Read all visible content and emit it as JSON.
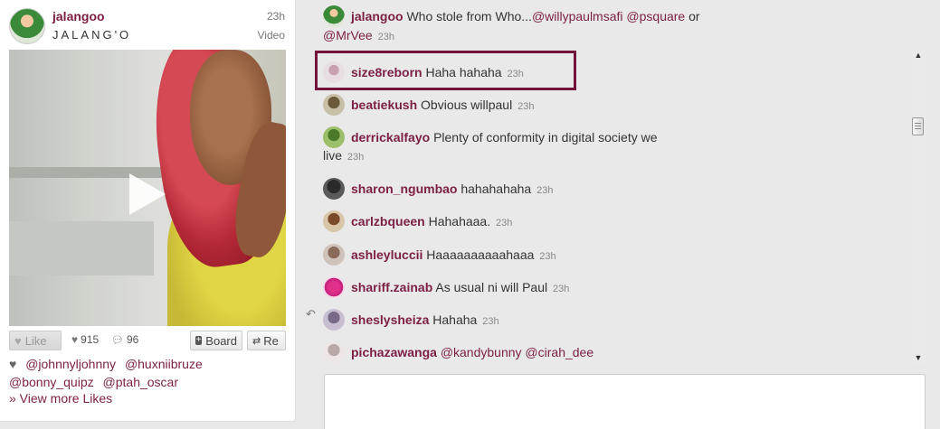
{
  "pin": {
    "author": "jalangoo",
    "author_subtitle": "JALANG'O",
    "time": "23h",
    "media_type": "Video",
    "like_label": "Like",
    "like_count": "915",
    "comment_count": "96",
    "board_label": "Board",
    "repin_label": "Re",
    "likers": [
      "@johnnyljohnny",
      "@huxniibruze",
      "@bonny_quipz",
      "@ptah_oscar"
    ],
    "view_more": "» View more Likes"
  },
  "top_comment": {
    "user": "jalangoo",
    "text": "Who stole from Who...",
    "mention1": "@willypaulmsafi",
    "mention2": "@psquare",
    "or": "or",
    "mention3": "@MrVee",
    "time": "23h"
  },
  "comments": [
    {
      "user": "size8reborn",
      "text": "Haha hahaha",
      "time": "23h"
    },
    {
      "user": "beatiekush",
      "text": "Obvious willpaul",
      "time": "23h"
    },
    {
      "user": "derrickalfayo",
      "text": "Plenty of conformity in digital society we",
      "text2": "live",
      "time": "23h"
    },
    {
      "user": "sharon_ngumbao",
      "text": "hahahahaha",
      "time": "23h"
    },
    {
      "user": "carlzbqueen",
      "text": "Hahahaaa.",
      "time": "23h"
    },
    {
      "user": "ashleyluccii",
      "text": "Haaaaaaaaaahaaa",
      "time": "23h"
    },
    {
      "user": "shariff.zainab",
      "text": "As usual ni will Paul",
      "time": "23h"
    },
    {
      "user": "sheslysheiza",
      "text": "Hahaha",
      "time": "23h"
    },
    {
      "user": "pichazawanga",
      "mention1": "@kandybunny",
      "mention2": "@cirah_dee"
    }
  ],
  "icons": {
    "like": "heart-icon",
    "comment": "speech-bubble-icon",
    "board": "plus-square-icon",
    "repin": "repin-arrows-icon",
    "play": "play-icon",
    "reply": "reply-arrow-icon"
  },
  "colors": {
    "accent": "#7b1f44",
    "highlight_border": "#74133a"
  }
}
